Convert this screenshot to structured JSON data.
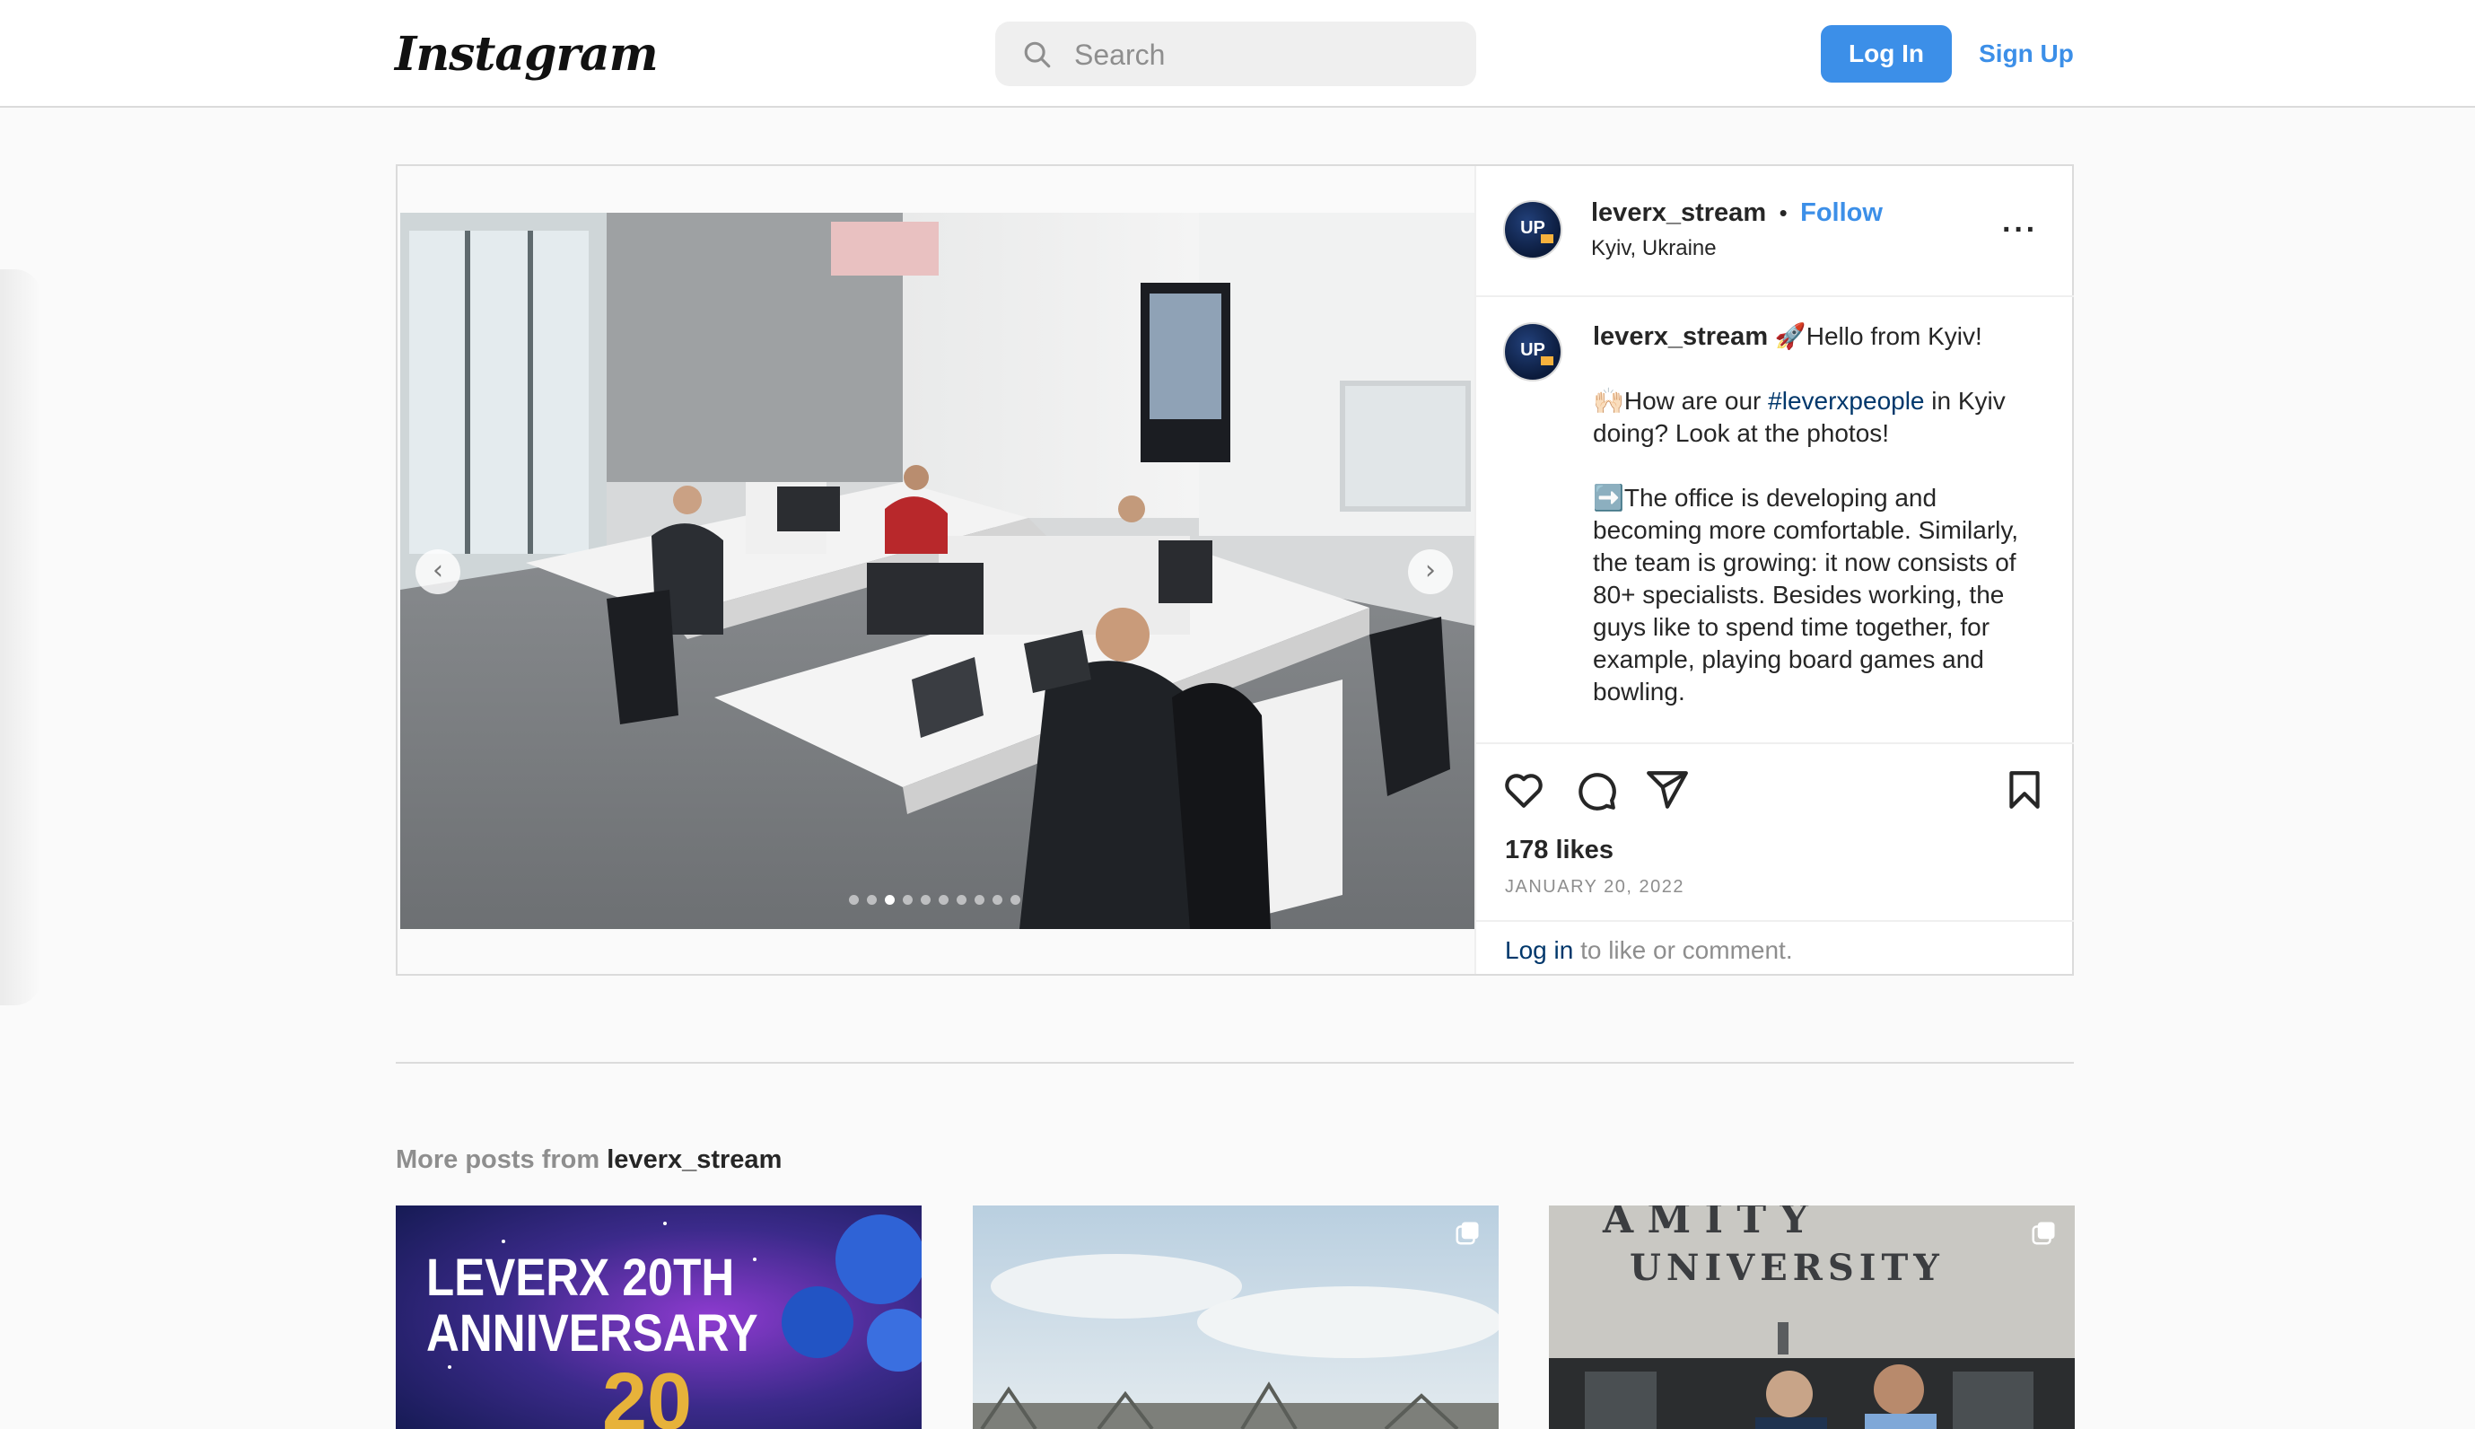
{
  "header": {
    "logo": "Instagram",
    "search_placeholder": "Search",
    "login_label": "Log In",
    "signup_label": "Sign Up"
  },
  "post": {
    "username": "leverx_stream",
    "follow_label": "Follow",
    "separator": "•",
    "location": "Kyiv, Ukraine",
    "more_label": "···",
    "avatar_text": "UP",
    "caption": {
      "username": "leverx_stream",
      "line1": "🚀Hello from Kyiv!",
      "p2_prefix": "🙌🏻How are our ",
      "hashtag": "#leverxpeople",
      "p2_suffix": " in Kyiv doing? Look at the photos!",
      "p3": "➡️The office is developing and becoming more comfortable. Similarly, the team is growing: it now consists of 80+ specialists. Besides working, the guys like to spend time together, for example, playing board games and bowling."
    },
    "likes": "178 likes",
    "date": "JANUARY 20, 2022",
    "login_prompt_link": "Log in",
    "login_prompt_rest": " to like or comment.",
    "carousel": {
      "count": 10,
      "active_index": 2
    },
    "icons": [
      "heart-icon",
      "comment-icon",
      "share-icon",
      "bookmark-icon"
    ]
  },
  "more_posts": {
    "title_prefix": "More posts from ",
    "username": "leverx_stream",
    "thumbnails": [
      {
        "text_line1": "LEVERX 20TH",
        "text_line2": "ANNIVERSARY",
        "badge": "20"
      },
      {
        "text_line1": ""
      },
      {
        "text_line1": "UNIVERSITY"
      }
    ]
  },
  "colors": {
    "accent": "#3c8fe8",
    "link": "#00376b",
    "border": "#dbdbdb",
    "muted": "#8e8e8e"
  }
}
